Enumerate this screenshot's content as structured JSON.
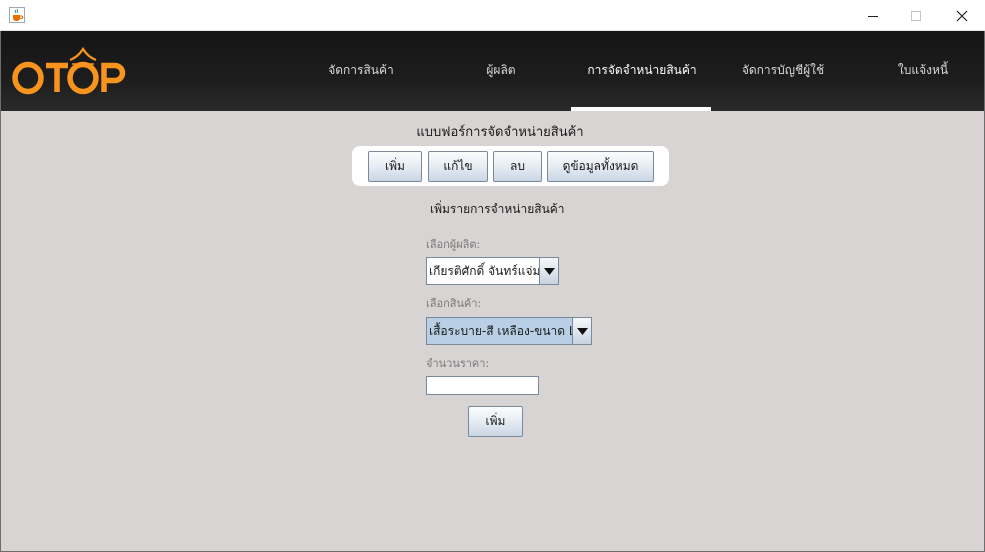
{
  "window": {
    "app_icon": "java-cup-icon",
    "controls": {
      "minimize": "minimize-icon",
      "maximize": "maximize-icon",
      "close": "close-icon"
    }
  },
  "header": {
    "logo_text": "OTOP",
    "nav": [
      {
        "label": "จัดการสินค้า"
      },
      {
        "label": "ผู้ผลิต"
      },
      {
        "label": "การจัดจำหน่ายสินค้า"
      },
      {
        "label": "จัดการบัญชีผู้ใช้"
      },
      {
        "label": "ใบแจ้งหนี้"
      }
    ],
    "active_nav_index": 2
  },
  "form": {
    "title": "แบบฟอร์การจัดจำหน่ายสินค้า",
    "buttons": {
      "add": "เพิ่ม",
      "edit": "แก้ไข",
      "delete": "ลบ",
      "view_all": "ดูข้อมูลทั้งหมด"
    },
    "section_title": "เพิ่มรายการจำหน่ายสินค้า",
    "producer_label": "เลือกผู้ผลิต:",
    "producer_value": "เกียรติศักดิ์ จันทร์แจ่ม",
    "product_label": "เลือกสินค้า:",
    "product_value": "เสื้อระบาย-สี เหลือง-ขนาด L",
    "price_label": "จำนวนราคา:",
    "price_value": "",
    "submit_label": "เพิ่ม"
  },
  "colors": {
    "background": "#d8d4d3",
    "header": "#1a1a1a",
    "logo_orange": "#f7941d",
    "combo_selected": "#b8cfe5"
  }
}
